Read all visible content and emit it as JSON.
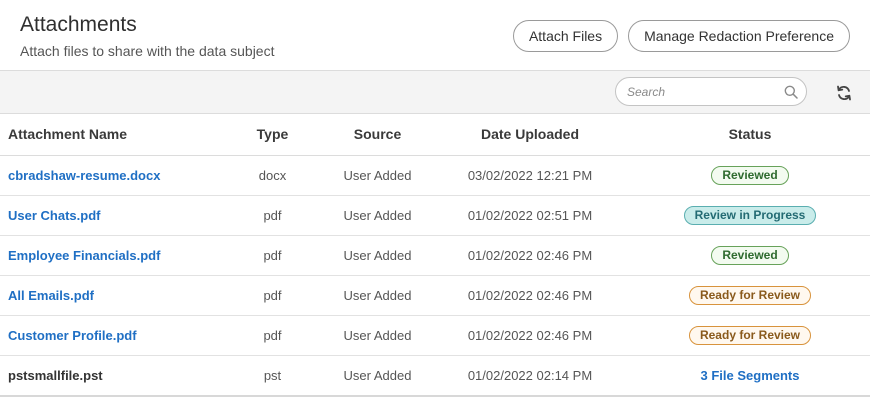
{
  "header": {
    "title": "Attachments",
    "subtitle": "Attach files to share with the data subject",
    "attach_files_label": "Attach Files",
    "manage_redaction_label": "Manage Redaction Preference"
  },
  "toolbar": {
    "search_placeholder": "Search"
  },
  "table": {
    "columns": [
      "Attachment Name",
      "Type",
      "Source",
      "Date Uploaded",
      "Status"
    ],
    "rows": [
      {
        "name": "cbradshaw-resume.docx",
        "type": "docx",
        "source": "User Added",
        "date": "03/02/2022 12:21 PM",
        "status": "Reviewed",
        "status_style": "green"
      },
      {
        "name": "User Chats.pdf",
        "type": "pdf",
        "source": "User Added",
        "date": "01/02/2022 02:51 PM",
        "status": "Review in Progress",
        "status_style": "teal"
      },
      {
        "name": "Employee Financials.pdf",
        "type": "pdf",
        "source": "User Added",
        "date": "01/02/2022 02:46 PM",
        "status": "Reviewed",
        "status_style": "green"
      },
      {
        "name": "All Emails.pdf",
        "type": "pdf",
        "source": "User Added",
        "date": "01/02/2022 02:46 PM",
        "status": "Ready for Review",
        "status_style": "orange"
      },
      {
        "name": "Customer Profile.pdf",
        "type": "pdf",
        "source": "User Added",
        "date": "01/02/2022 02:46 PM",
        "status": "Ready for Review",
        "status_style": "orange"
      },
      {
        "name": "pstsmallfile.pst",
        "type": "pst",
        "source": "User Added",
        "date": "01/02/2022 02:14 PM",
        "status": "3 File Segments",
        "status_style": "link"
      }
    ]
  },
  "icons": {
    "search": "search-icon",
    "refresh": "refresh-icon"
  },
  "colors": {
    "link": "#1f6fc4",
    "reviewed": "#67a25a",
    "in_progress": "#5aaeb0",
    "ready": "#d8933c"
  }
}
